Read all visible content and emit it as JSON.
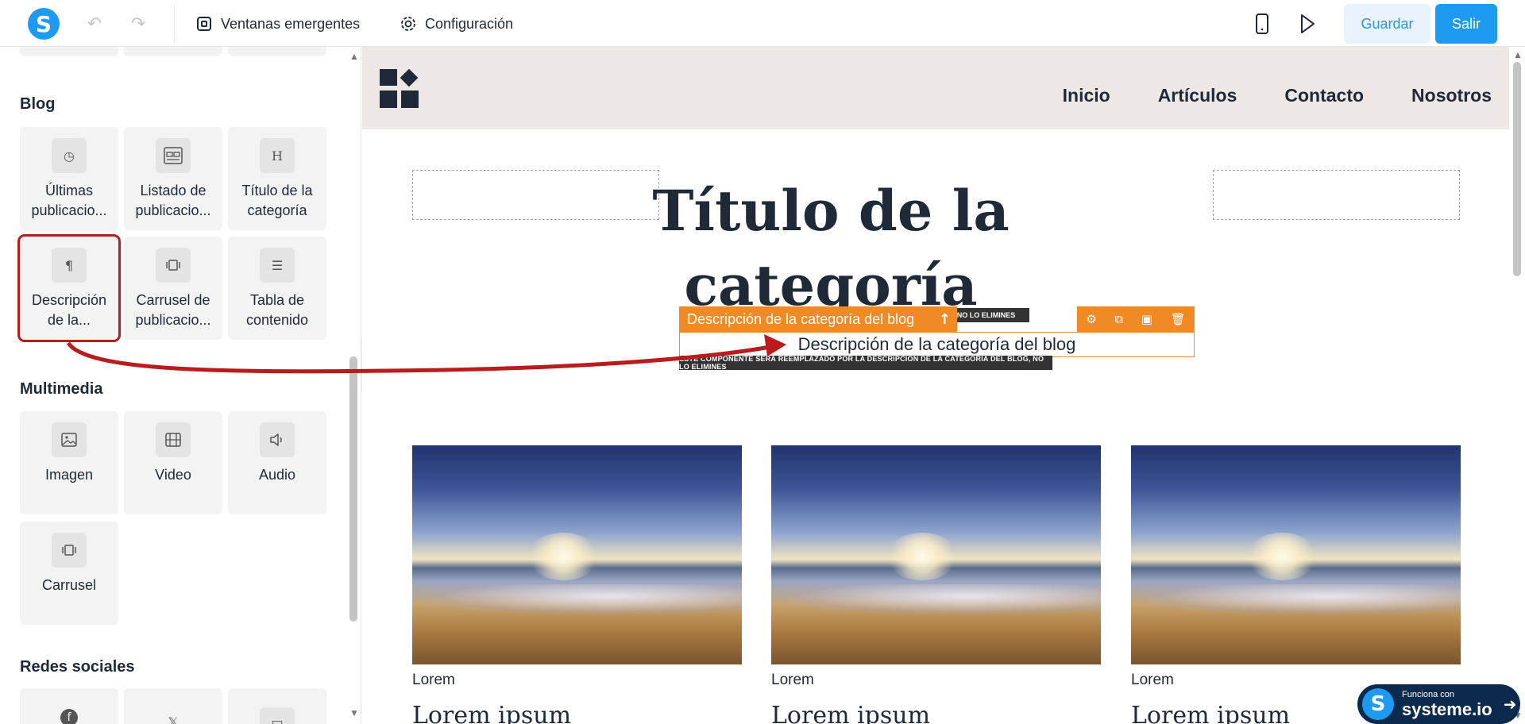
{
  "topbar": {
    "popups_label": "Ventanas emergentes",
    "config_label": "Configuración",
    "save_label": "Guardar",
    "exit_label": "Salir"
  },
  "sidebar": {
    "blog_title": "Blog",
    "blog_items": [
      {
        "label": "Últimas publicacio...",
        "icon": "clock-icon"
      },
      {
        "label": "Listado de publicacio...",
        "icon": "grid-list-icon"
      },
      {
        "label": "Título de la categoría",
        "icon": "heading-icon"
      },
      {
        "label": "Descripción de la...",
        "icon": "paragraph-icon"
      },
      {
        "label": "Carrusel de publicacio...",
        "icon": "carousel-icon"
      },
      {
        "label": "Tabla de contenido",
        "icon": "list-icon"
      }
    ],
    "media_title": "Multimedia",
    "media_items": [
      {
        "label": "Imagen",
        "icon": "image-icon"
      },
      {
        "label": "Video",
        "icon": "video-icon"
      },
      {
        "label": "Audio",
        "icon": "audio-icon"
      },
      {
        "label": "Carrusel",
        "icon": "carousel-icon"
      }
    ],
    "social_title": "Redes sociales"
  },
  "canvas": {
    "nav": [
      "Inicio",
      "Artículos",
      "Contacto",
      "Nosotros"
    ],
    "category_title": "Título de la categoría",
    "editor_label": "Descripción de la categoría del blog",
    "editor_text": "Descripción de la categoría del blog",
    "note_top": "BLOG, NO LO ELIMINES",
    "note_bottom": "ESTE COMPONENTE SERÁ REEMPLAZADO POR LA DESCRIPCIÓN DE LA CATEGORÍA DEL BLOG, NO LO ELIMINES",
    "posts": [
      {
        "category": "Lorem",
        "title": "Lorem ipsum"
      },
      {
        "category": "Lorem",
        "title": "Lorem ipsum"
      },
      {
        "category": "Lorem",
        "title": "Lorem ipsum"
      }
    ]
  },
  "badge": {
    "small": "Funciona con",
    "big": "systeme.io"
  },
  "colors": {
    "brand": "#1e9bf0",
    "editor_accent": "#f08a24",
    "selection": "#b91c1c"
  }
}
